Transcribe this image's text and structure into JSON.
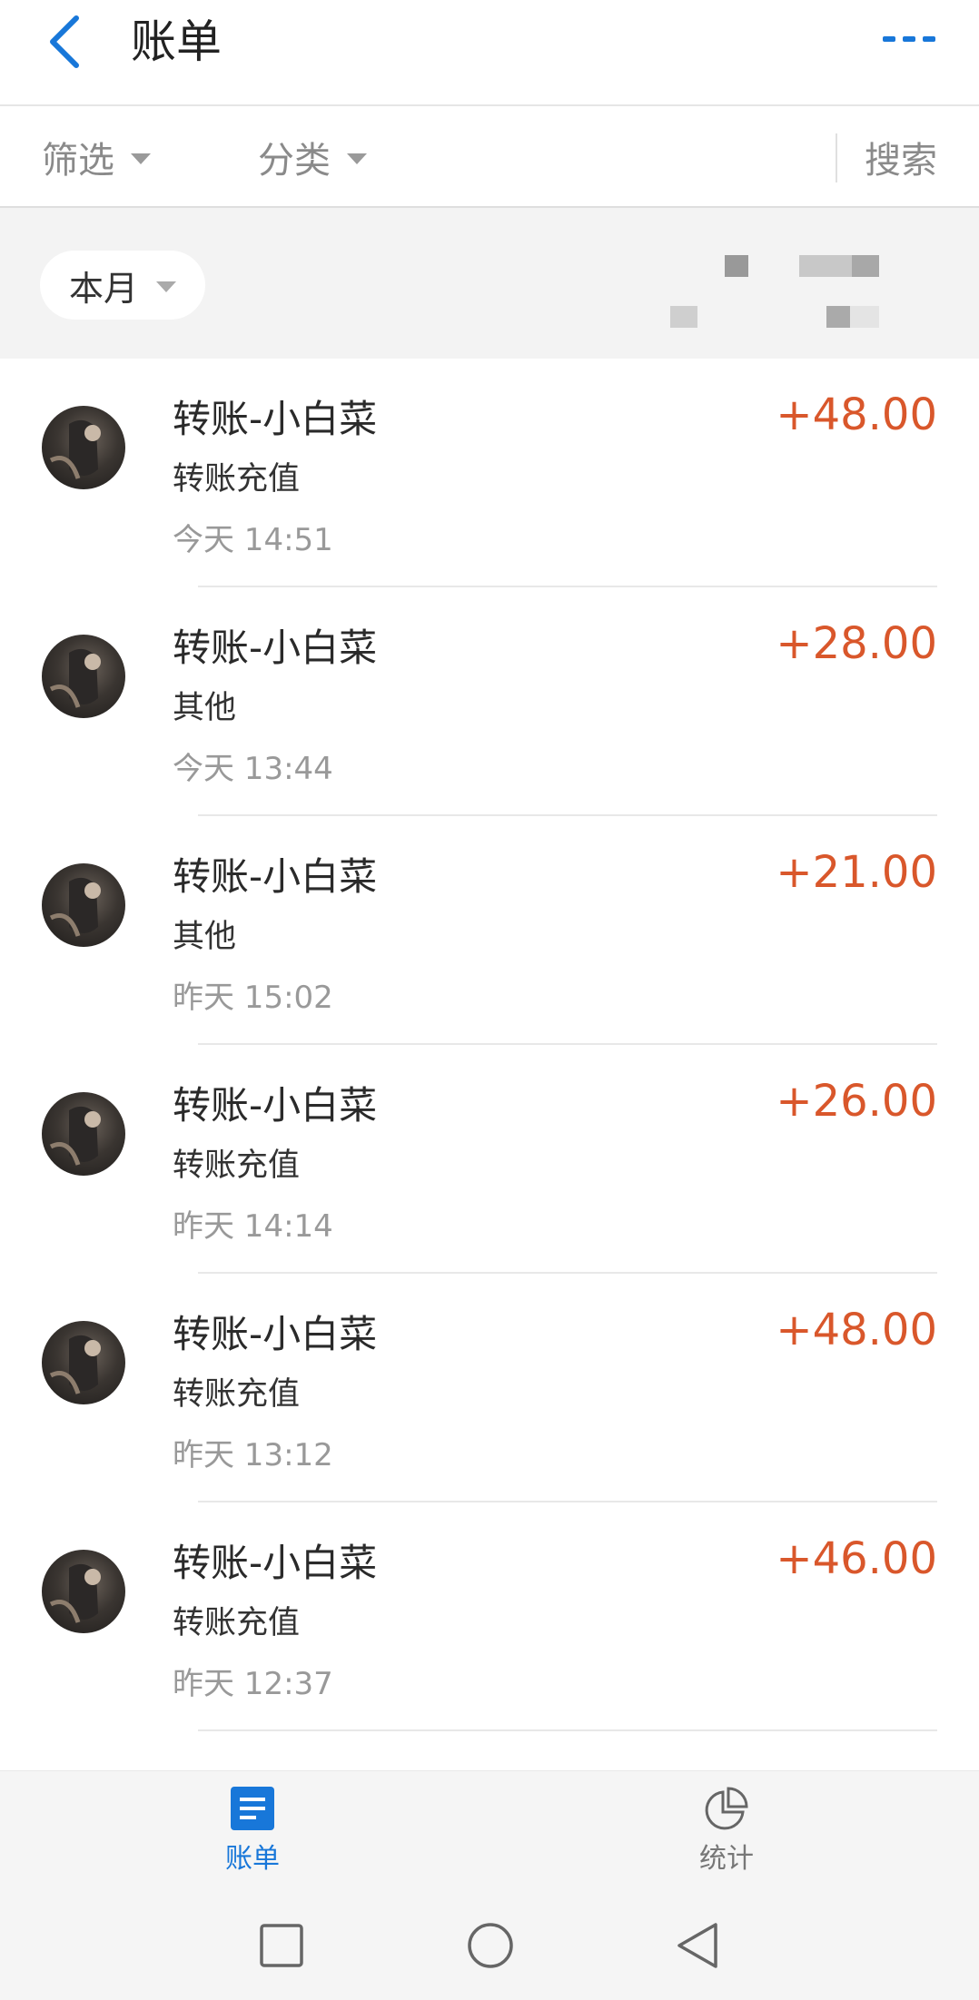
{
  "header": {
    "title": "账单"
  },
  "filters": {
    "filter_label": "筛选",
    "category_label": "分类",
    "search_label": "搜索"
  },
  "period": {
    "selected": "本月"
  },
  "transactions": [
    {
      "name": "转账-小白菜",
      "type": "转账充值",
      "time": "今天 14:51",
      "amount": "+48.00"
    },
    {
      "name": "转账-小白菜",
      "type": "其他",
      "time": "今天 13:44",
      "amount": "+28.00"
    },
    {
      "name": "转账-小白菜",
      "type": "其他",
      "time": "昨天 15:02",
      "amount": "+21.00"
    },
    {
      "name": "转账-小白菜",
      "type": "转账充值",
      "time": "昨天 14:14",
      "amount": "+26.00"
    },
    {
      "name": "转账-小白菜",
      "type": "转账充值",
      "time": "昨天 13:12",
      "amount": "+48.00"
    },
    {
      "name": "转账-小白菜",
      "type": "转账充值",
      "time": "昨天 12:37",
      "amount": "+46.00"
    }
  ],
  "tabbar": {
    "bills_label": "账单",
    "stats_label": "统计"
  },
  "colors": {
    "accent": "#1877d9",
    "amount": "#d9572b"
  }
}
